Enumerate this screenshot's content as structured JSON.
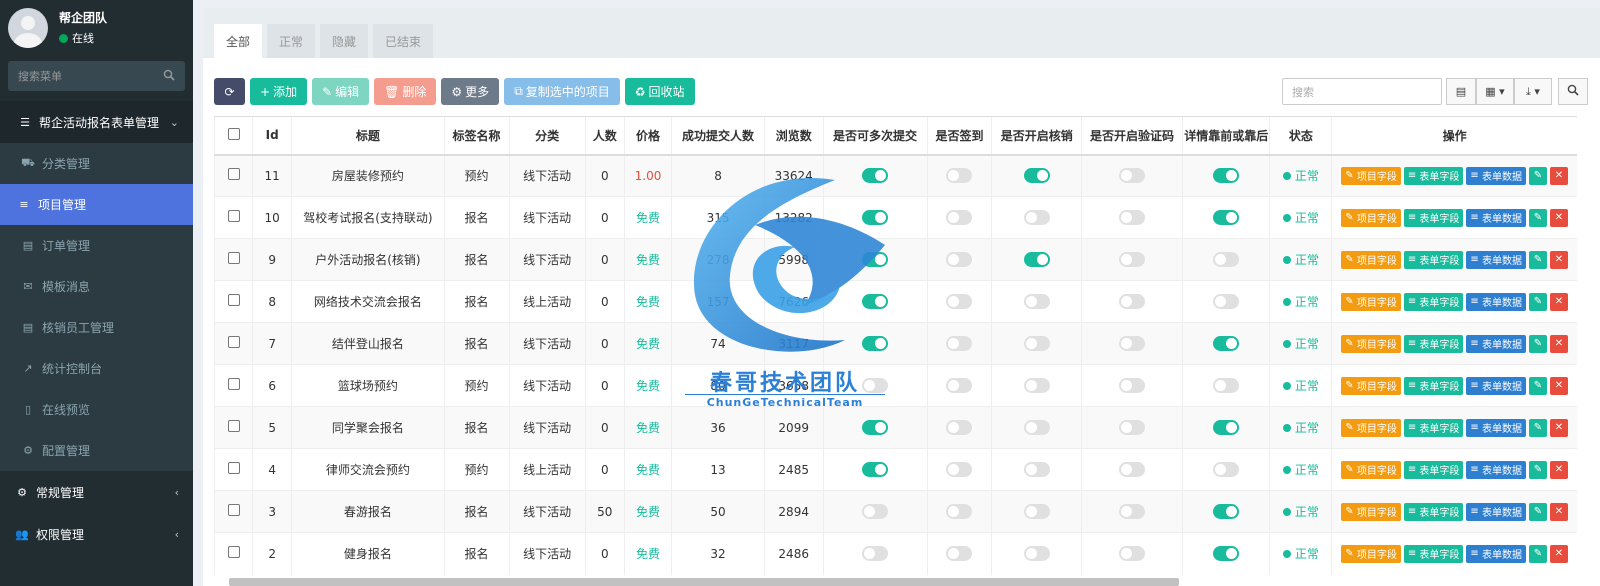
{
  "user": {
    "name": "帮企团队",
    "status": "在线"
  },
  "sidebar": {
    "search_placeholder": "搜索菜单",
    "group_main": "帮企活动报名表单管理",
    "items": [
      {
        "label": "分类管理",
        "icon": "cart-icon",
        "glyph": "⛟"
      },
      {
        "label": "项目管理",
        "icon": "list-icon",
        "glyph": "≡"
      },
      {
        "label": "订单管理",
        "icon": "file-icon",
        "glyph": "▤"
      },
      {
        "label": "模板消息",
        "icon": "envelope-icon",
        "glyph": "✉"
      },
      {
        "label": "核销员工管理",
        "icon": "file-icon",
        "glyph": "▤"
      },
      {
        "label": "统计控制台",
        "icon": "chart-icon",
        "glyph": "↗"
      },
      {
        "label": "在线预览",
        "icon": "mobile-icon",
        "glyph": "▯"
      },
      {
        "label": "配置管理",
        "icon": "cogs-icon",
        "glyph": "⚙"
      }
    ],
    "group_general": "常规管理",
    "group_permission": "权限管理"
  },
  "tabs": [
    "全部",
    "正常",
    "隐藏",
    "已结束"
  ],
  "toolbar": {
    "add": "添加",
    "edit": "编辑",
    "delete": "删除",
    "more": "更多",
    "copy": "复制选中的项目",
    "recycle": "回收站"
  },
  "search": {
    "placeholder": "搜索"
  },
  "table": {
    "headers": [
      "",
      "Id",
      "标题",
      "标签名称",
      "分类",
      "人数",
      "价格",
      "成功提交人数",
      "浏览数",
      "是否可多次提交",
      "是否签到",
      "是否开启核销",
      "是否开启验证码",
      "详情靠前或靠后",
      "状态",
      "操作"
    ],
    "ops": {
      "field": "项目字段",
      "form_field": "表单字段",
      "form_data": "表单数据"
    },
    "rows": [
      {
        "id": "11",
        "title": "房屋装修预约",
        "tag": "预约",
        "category": "线下活动",
        "people": "0",
        "price": "1.00",
        "price_type": "red",
        "submitted": "8",
        "views": "33624",
        "multi": true,
        "signin": false,
        "verify": true,
        "captcha": false,
        "detail": true,
        "status": "正常"
      },
      {
        "id": "10",
        "title": "驾校考试报名(支持联动)",
        "tag": "报名",
        "category": "线下活动",
        "people": "0",
        "price": "免费",
        "price_type": "green",
        "submitted": "315",
        "views": "13282",
        "multi": true,
        "signin": false,
        "verify": false,
        "captcha": false,
        "detail": true,
        "status": "正常"
      },
      {
        "id": "9",
        "title": "户外活动报名(核销)",
        "tag": "报名",
        "category": "线下活动",
        "people": "0",
        "price": "免费",
        "price_type": "green",
        "submitted": "278",
        "views": "5998",
        "multi": true,
        "signin": false,
        "verify": true,
        "captcha": false,
        "detail": false,
        "status": "正常"
      },
      {
        "id": "8",
        "title": "网络技术交流会报名",
        "tag": "报名",
        "category": "线上活动",
        "people": "0",
        "price": "免费",
        "price_type": "green",
        "submitted": "157",
        "views": "7626",
        "multi": true,
        "signin": false,
        "verify": false,
        "captcha": false,
        "detail": false,
        "status": "正常"
      },
      {
        "id": "7",
        "title": "结伴登山报名",
        "tag": "报名",
        "category": "线下活动",
        "people": "0",
        "price": "免费",
        "price_type": "green",
        "submitted": "74",
        "views": "3117",
        "multi": true,
        "signin": false,
        "verify": false,
        "captcha": false,
        "detail": true,
        "status": "正常"
      },
      {
        "id": "6",
        "title": "篮球场预约",
        "tag": "预约",
        "category": "线下活动",
        "people": "0",
        "price": "免费",
        "price_type": "green",
        "submitted": "80",
        "views": "3658",
        "multi": false,
        "signin": false,
        "verify": false,
        "captcha": false,
        "detail": false,
        "status": "正常"
      },
      {
        "id": "5",
        "title": "同学聚会报名",
        "tag": "报名",
        "category": "线下活动",
        "people": "0",
        "price": "免费",
        "price_type": "green",
        "submitted": "36",
        "views": "2099",
        "multi": true,
        "signin": false,
        "verify": false,
        "captcha": false,
        "detail": true,
        "status": "正常"
      },
      {
        "id": "4",
        "title": "律师交流会预约",
        "tag": "预约",
        "category": "线上活动",
        "people": "0",
        "price": "免费",
        "price_type": "green",
        "submitted": "13",
        "views": "2485",
        "multi": true,
        "signin": false,
        "verify": false,
        "captcha": false,
        "detail": false,
        "status": "正常"
      },
      {
        "id": "3",
        "title": "春游报名",
        "tag": "报名",
        "category": "线下活动",
        "people": "50",
        "price": "免费",
        "price_type": "green",
        "submitted": "50",
        "views": "2894",
        "multi": false,
        "signin": false,
        "verify": false,
        "captcha": false,
        "detail": true,
        "status": "正常"
      },
      {
        "id": "2",
        "title": "健身报名",
        "tag": "报名",
        "category": "线下活动",
        "people": "0",
        "price": "免费",
        "price_type": "green",
        "submitted": "32",
        "views": "2486",
        "multi": false,
        "signin": false,
        "verify": false,
        "captcha": false,
        "detail": true,
        "status": "正常"
      }
    ]
  },
  "watermark": {
    "title": "春哥技术团队",
    "subtitle": "ChunGeTechnicalTeam"
  },
  "colors": {
    "sidebar_bg": "#222d32",
    "active": "#4e73df",
    "success": "#18bc9c",
    "danger": "#e74c3c",
    "warning": "#f39c12"
  }
}
